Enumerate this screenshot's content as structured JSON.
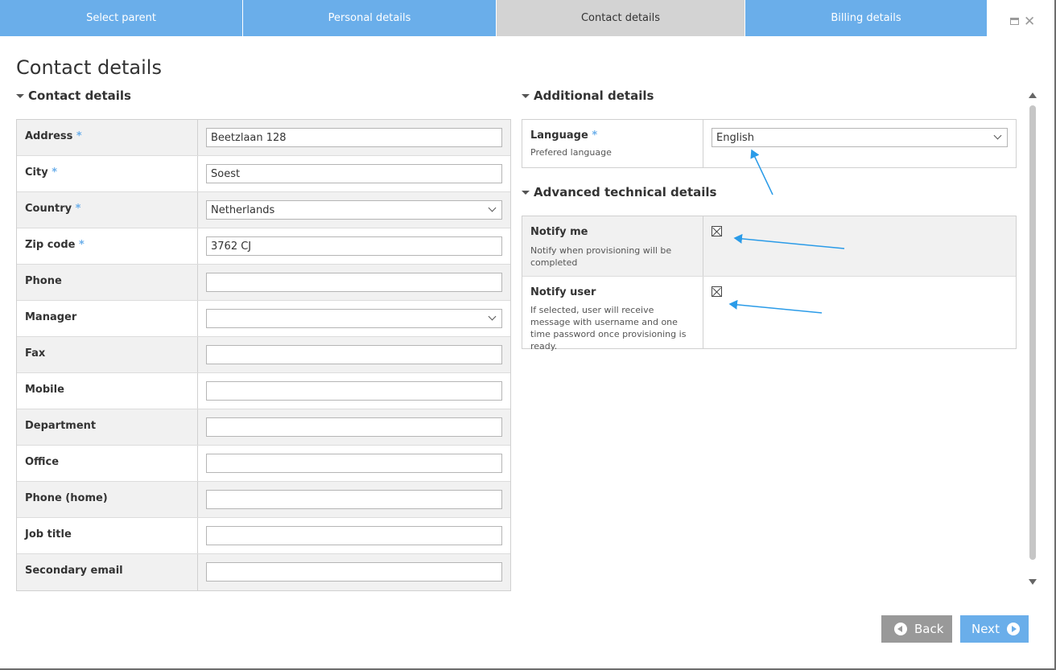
{
  "tabs": [
    "Select parent",
    "Personal details",
    "Contact details",
    "Billing details"
  ],
  "active_tab": 2,
  "page_title": "Contact details",
  "contact_section": {
    "title": "Contact details",
    "fields": [
      {
        "label": "Address",
        "required": "*",
        "value": "Beetzlaan 128",
        "type": "text"
      },
      {
        "label": "City",
        "required": "*",
        "value": "Soest",
        "type": "text"
      },
      {
        "label": "Country",
        "required": "*",
        "value": "Netherlands",
        "type": "select"
      },
      {
        "label": "Zip code",
        "required": "*",
        "value": "3762 CJ",
        "type": "text"
      },
      {
        "label": "Phone",
        "required": "",
        "value": "",
        "type": "text"
      },
      {
        "label": "Manager",
        "required": "",
        "value": "",
        "type": "select"
      },
      {
        "label": "Fax",
        "required": "",
        "value": "",
        "type": "text"
      },
      {
        "label": "Mobile",
        "required": "",
        "value": "",
        "type": "text"
      },
      {
        "label": "Department",
        "required": "",
        "value": "",
        "type": "text"
      },
      {
        "label": "Office",
        "required": "",
        "value": "",
        "type": "text"
      },
      {
        "label": "Phone (home)",
        "required": "",
        "value": "",
        "type": "text"
      },
      {
        "label": "Job title",
        "required": "",
        "value": "",
        "type": "text"
      },
      {
        "label": "Secondary email",
        "required": "",
        "value": "",
        "type": "text"
      }
    ]
  },
  "additional_section": {
    "title": "Additional details",
    "language": {
      "label": "Language",
      "required": "*",
      "sub": "Prefered language",
      "value": "English"
    }
  },
  "advanced_section": {
    "title": "Advanced technical details",
    "notify_me": {
      "label": "Notify me",
      "sub": "Notify when provisioning will be completed"
    },
    "notify_user": {
      "label": "Notify user",
      "sub": "If selected, user will receive message with username and one time password once provisioning is ready."
    }
  },
  "buttons": {
    "back": "Back",
    "next": "Next"
  },
  "colors": {
    "accent": "#6aaeea",
    "annotation": "#2a9be8"
  }
}
